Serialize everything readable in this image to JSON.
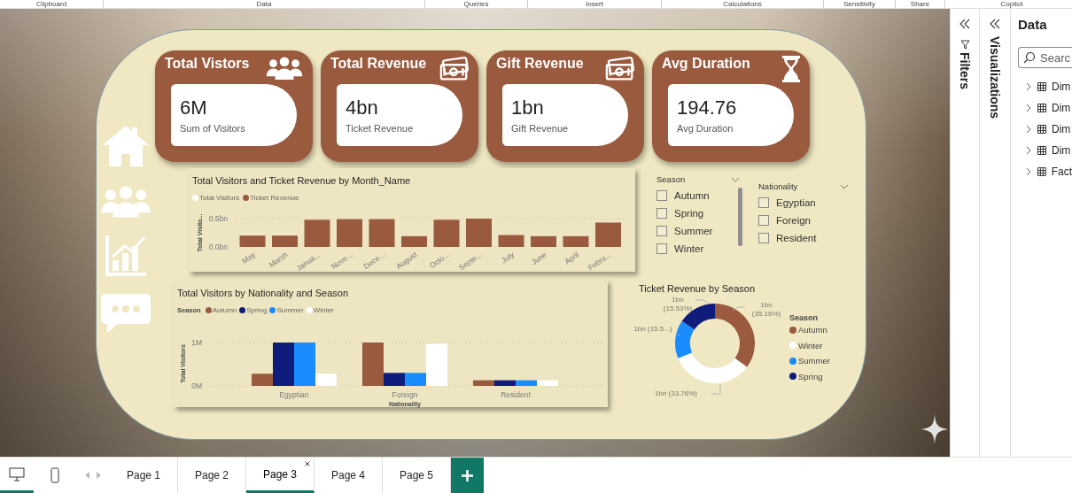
{
  "ribbon": {
    "groups": [
      "Clipboard",
      "Data",
      "Queries",
      "Insert",
      "Calculations",
      "Sensitivity",
      "Share",
      "Copilot"
    ]
  },
  "report": {
    "kpis": [
      {
        "title": "Total Vistors",
        "value": "6M",
        "caption": "Sum of Visitors"
      },
      {
        "title": "Total Revenue",
        "value": "4bn",
        "caption": "Ticket Revenue"
      },
      {
        "title": "Gift Revenue",
        "value": "1bn",
        "caption": "Gift Revenue"
      },
      {
        "title": "Avg Duration",
        "value": "194.76",
        "caption": "Avg Duration"
      }
    ],
    "month_chart": {
      "chart_data": {
        "type": "bar",
        "title": "Total Visitors and Ticket Revenue by Month_Name",
        "ylabel": "Total Visito...",
        "categories": [
          "May",
          "March",
          "Janua...",
          "Nove...",
          "Dece...",
          "August",
          "Octo...",
          "Septe...",
          "July",
          "June",
          "April",
          "Febru..."
        ],
        "series": [
          {
            "name": "Total Visitors",
            "color": "#ffffff",
            "values": [
              null,
              null,
              null,
              null,
              null,
              null,
              null,
              null,
              null,
              null,
              null,
              null
            ]
          },
          {
            "name": "Ticket Revenue",
            "color": "#9a5a3e",
            "values": [
              0.2,
              0.2,
              0.48,
              0.49,
              0.49,
              0.19,
              0.48,
              0.5,
              0.21,
              0.19,
              0.19,
              0.43
            ]
          }
        ],
        "ylim": [
          0,
          0.5
        ],
        "yticks": [
          {
            "value": 0,
            "label": "0.0bn"
          },
          {
            "value": 0.5,
            "label": "0.5bn"
          }
        ]
      }
    },
    "season_slicer": {
      "title": "Season",
      "items": [
        {
          "label": "Autumn",
          "checked": false
        },
        {
          "label": "Spring",
          "checked": false
        },
        {
          "label": "Summer",
          "checked": false
        },
        {
          "label": "Winter",
          "checked": false
        }
      ]
    },
    "nationality_slicer": {
      "title": "Nationality",
      "items": [
        {
          "label": "Egyptian",
          "checked": false
        },
        {
          "label": "Foreign",
          "checked": false
        },
        {
          "label": "Resident",
          "checked": false
        }
      ]
    },
    "nationality_chart": {
      "legend_title": "Season",
      "chart_data": {
        "type": "bar",
        "title": "Total Visitors by Nationality and Season",
        "xlabel": "Nationality",
        "ylabel": "Total Visitors",
        "categories": [
          "Egyptian",
          "Foreign",
          "Resident"
        ],
        "series": [
          {
            "name": "Autumn",
            "color": "#9a5a3e",
            "values": [
              0.28,
              1,
              0.13
            ]
          },
          {
            "name": "Spring",
            "color": "#101c7c",
            "values": [
              1,
              0.3,
              0.13
            ]
          },
          {
            "name": "Summer",
            "color": "#1a8cff",
            "values": [
              1,
              0.3,
              0.13
            ]
          },
          {
            "name": "Winter",
            "color": "#ffffff",
            "values": [
              0.28,
              0.97,
              0.13
            ]
          }
        ],
        "ylim": [
          0,
          1
        ],
        "yticks": [
          {
            "value": 0,
            "label": "0M"
          },
          {
            "value": 1,
            "label": "1M"
          }
        ]
      }
    },
    "season_donut": {
      "legend_title": "Season",
      "chart_data": {
        "type": "donut",
        "title": "Ticket Revenue by Season",
        "categories": [
          "Autumn",
          "Winter",
          "Summer",
          "Spring"
        ],
        "colors": [
          "#9a5a3e",
          "#ffffff",
          "#1a8cff",
          "#101c7c"
        ],
        "values": [
          35.16,
          33.76,
          15.55,
          15.53
        ],
        "value_labels": [
          "1bn (35.16%)",
          "1bn (33.76%)",
          "1bn (15.5...)",
          "1bn (15.53%)"
        ]
      }
    }
  },
  "panes": {
    "filters": {
      "title": "Filters"
    },
    "visualizations": {
      "title": "Visualizations"
    },
    "data": {
      "title": "Data",
      "search": {
        "placeholder": "Searc"
      },
      "tables": [
        {
          "label": "Dim",
          "expanded": false
        },
        {
          "label": "Dim",
          "expanded": false
        },
        {
          "label": "Dim",
          "expanded": false
        },
        {
          "label": "Dim",
          "expanded": false
        },
        {
          "label": "Fact",
          "expanded": false
        }
      ]
    }
  },
  "page_tabs": [
    {
      "label": "Page 1",
      "selected": false
    },
    {
      "label": "Page 2",
      "selected": false
    },
    {
      "label": "Page 3",
      "selected": true
    },
    {
      "label": "Page 4",
      "selected": false
    },
    {
      "label": "Page 5",
      "selected": false
    }
  ]
}
